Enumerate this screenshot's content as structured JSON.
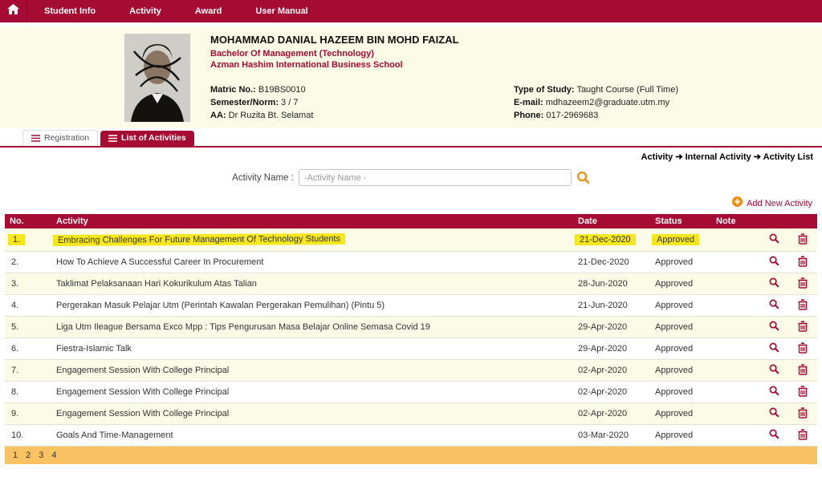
{
  "colors": {
    "maroon": "#a50b33",
    "pale_yellow": "#fbfbe8",
    "highlight_yellow": "#f6e71c",
    "orange": "#ef8f0a",
    "pagination_orange": "#f9c365"
  },
  "nav": {
    "items": [
      {
        "label": "Student Info"
      },
      {
        "label": "Activity"
      },
      {
        "label": "Award"
      },
      {
        "label": "User Manual"
      }
    ]
  },
  "student": {
    "name": "MOHAMMAD DANIAL HAZEEM BIN MOHD FAIZAL",
    "programme": "Bachelor Of Management (Technology)",
    "school": "Azman Hashim International Business School",
    "info_left": [
      {
        "label": "Matric No.:",
        "value": "B19BS0010"
      },
      {
        "label": "Semester/Norm:",
        "value": "3 / 7"
      },
      {
        "label": "AA:",
        "value": "Dr Ruzita Bt. Selamat"
      }
    ],
    "info_right": [
      {
        "label": "Type of Study:",
        "value": "Taught Course (Full Time)"
      },
      {
        "label": "E-mail:",
        "value": "mdhazeem2@graduate.utm.my"
      },
      {
        "label": "Phone:",
        "value": "017-2969683"
      }
    ]
  },
  "tabs": [
    {
      "label": "Registration",
      "active": false
    },
    {
      "label": "List of Activities",
      "active": true
    }
  ],
  "breadcrumb": "Activity ➔ Internal Activity ➔ Activity List",
  "search": {
    "label": "Activity Name :",
    "placeholder": "-Activity Name -",
    "value": ""
  },
  "add_new_label": "Add New Activity",
  "table": {
    "columns": [
      "No.",
      "Activity",
      "Date",
      "Status",
      "Note"
    ],
    "rows": [
      {
        "no": "1.",
        "activity": "Embracing Challenges For Future Management Of Technology Students",
        "date": "21-Dec-2020",
        "status": "Approved",
        "note": "",
        "highlighted": true
      },
      {
        "no": "2.",
        "activity": "How To Achieve A Successful Career In Procurement",
        "date": "21-Dec-2020",
        "status": "Approved",
        "note": "",
        "highlighted": false
      },
      {
        "no": "3.",
        "activity": "Taklimat Pelaksanaan Hari Kokurikulum Atas Talian",
        "date": "28-Jun-2020",
        "status": "Approved",
        "note": "",
        "highlighted": false
      },
      {
        "no": "4.",
        "activity": "Pergerakan Masuk Pelajar Utm (Perintah Kawalan Pergerakan Pemulihan) (Pintu 5)",
        "date": "21-Jun-2020",
        "status": "Approved",
        "note": "",
        "highlighted": false
      },
      {
        "no": "5.",
        "activity": "Liga Utm Ileague Bersama Exco Mpp : Tips Pengurusan Masa Belajar Online Semasa Covid 19",
        "date": "29-Apr-2020",
        "status": "Approved",
        "note": "",
        "highlighted": false
      },
      {
        "no": "6.",
        "activity": "Fiestra-Islamic Talk",
        "date": "29-Apr-2020",
        "status": "Approved",
        "note": "",
        "highlighted": false
      },
      {
        "no": "7.",
        "activity": "Engagement Session With College Principal",
        "date": "02-Apr-2020",
        "status": "Approved",
        "note": "",
        "highlighted": false
      },
      {
        "no": "8.",
        "activity": "Engagement Session With College Principal",
        "date": "02-Apr-2020",
        "status": "Approved",
        "note": "",
        "highlighted": false
      },
      {
        "no": "9.",
        "activity": "Engagement Session With College Principal",
        "date": "02-Apr-2020",
        "status": "Approved",
        "note": "",
        "highlighted": false
      },
      {
        "no": "10.",
        "activity": "Goals And Time-Management",
        "date": "03-Mar-2020",
        "status": "Approved",
        "note": "",
        "highlighted": false
      }
    ]
  },
  "pagination": {
    "pages": [
      "1",
      "2",
      "3",
      "4"
    ]
  }
}
